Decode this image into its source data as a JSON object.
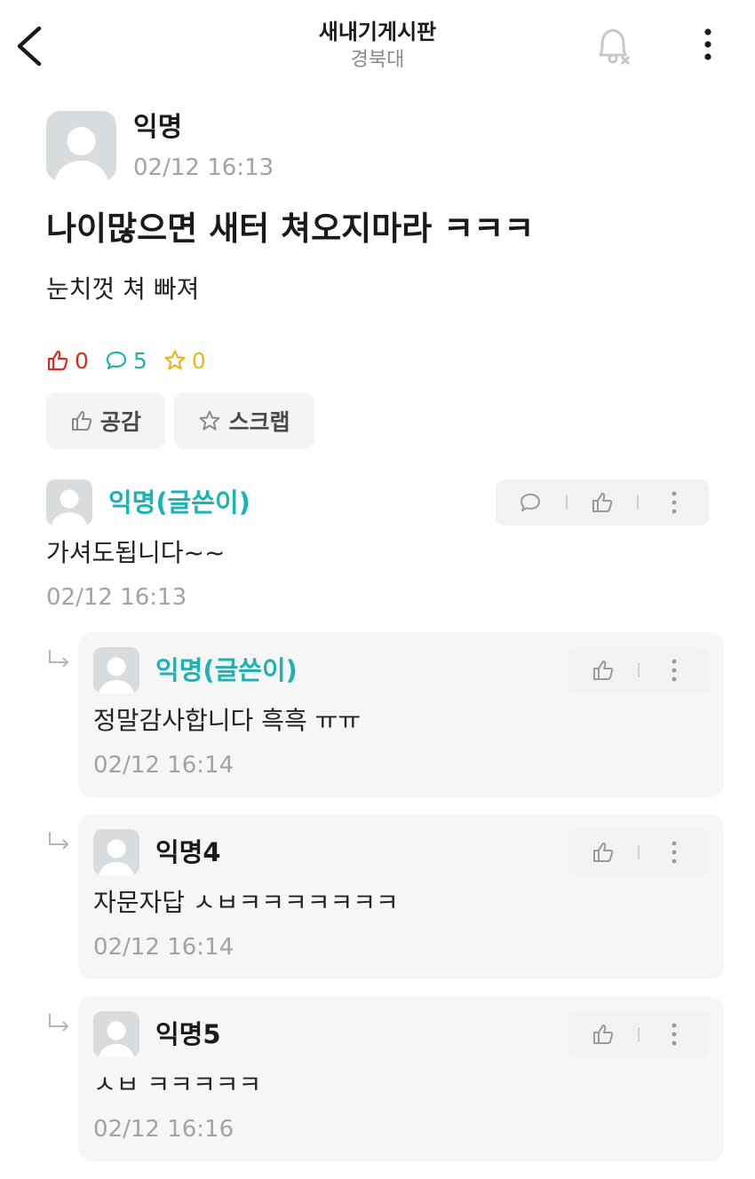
{
  "header": {
    "title": "새내기게시판",
    "subtitle": "경북대"
  },
  "post": {
    "author": "익명",
    "time": "02/12 16:13",
    "title": "나이많으면 새터 쳐오지마라 ㅋㅋㅋ",
    "body": "눈치껏 쳐 빠져",
    "likes": "0",
    "comments": "5",
    "scraps": "0",
    "like_button": "공감",
    "scrap_button": "스크랩"
  },
  "comments": [
    {
      "author": "익명(글쓴이)",
      "text": "가셔도됩니다~~",
      "time": "02/12 16:13"
    }
  ],
  "replies": [
    {
      "author": "익명(글쓴이)",
      "text": "정말감사합니다 흑흑 ㅠㅠ",
      "time": "02/12 16:14"
    },
    {
      "author": "익명4",
      "text": "자문자답 ㅅㅂㅋㅋㅋㅋㅋㅋㅋ",
      "time": "02/12 16:14"
    },
    {
      "author": "익명5",
      "text": "ㅅㅂ ㅋㅋㅋㅋㅋ",
      "time": "02/12 16:16"
    }
  ],
  "colors": {
    "accent_teal": "#1eb3b3",
    "like_red": "#e0281e",
    "scrap_yellow": "#e8b81a"
  }
}
